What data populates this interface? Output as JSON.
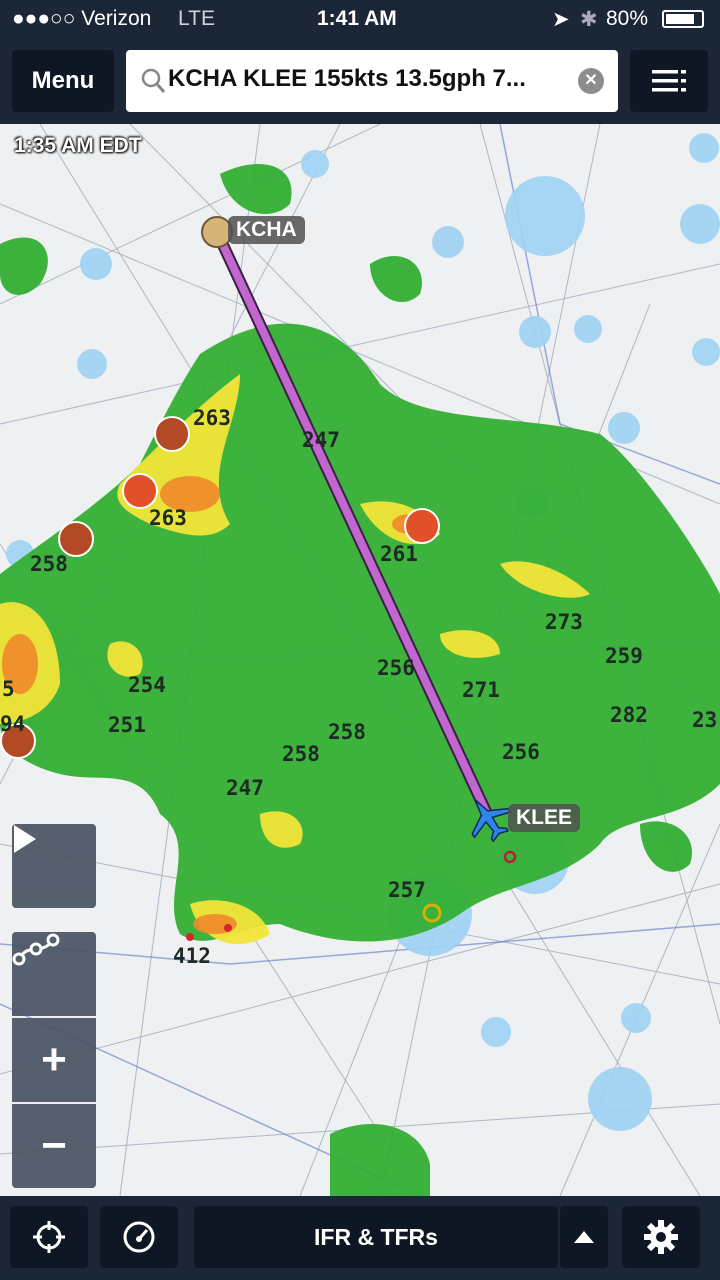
{
  "status_bar": {
    "carrier": "●●●○○ Verizon",
    "network": "LTE",
    "time": "1:41 AM",
    "battery": "80%"
  },
  "top_bar": {
    "menu_label": "Menu",
    "search_value": "KCHA KLEE 155kts 13.5gph 7...",
    "clear_icon": "close-icon",
    "list_icon": "list-icon"
  },
  "map": {
    "timestamp": "1:35 AM EDT",
    "origin": "KCHA",
    "destination": "KLEE",
    "tops_labels": [
      "263",
      "247",
      "263",
      "261",
      "258",
      "273",
      "256",
      "259",
      "254",
      "271",
      "5",
      "94",
      "251",
      "282",
      "23",
      "258",
      "258",
      "256",
      "247",
      "257",
      "412"
    ]
  },
  "side_controls": {
    "play": "play-icon",
    "route": "route-icon",
    "zoom_in": "+",
    "zoom_out": "−"
  },
  "bottom_bar": {
    "layer_label": "IFR & TFRs",
    "locate": "crosshair-icon",
    "gauge": "gauge-icon",
    "expand": "caret-up-icon",
    "settings": "gear-icon"
  },
  "colors": {
    "bar": "#1b2637",
    "route": "#d26fe0",
    "radar_green": "#2fae2f",
    "radar_yellow": "#f2e538",
    "airspace": "#9fd3f4"
  }
}
